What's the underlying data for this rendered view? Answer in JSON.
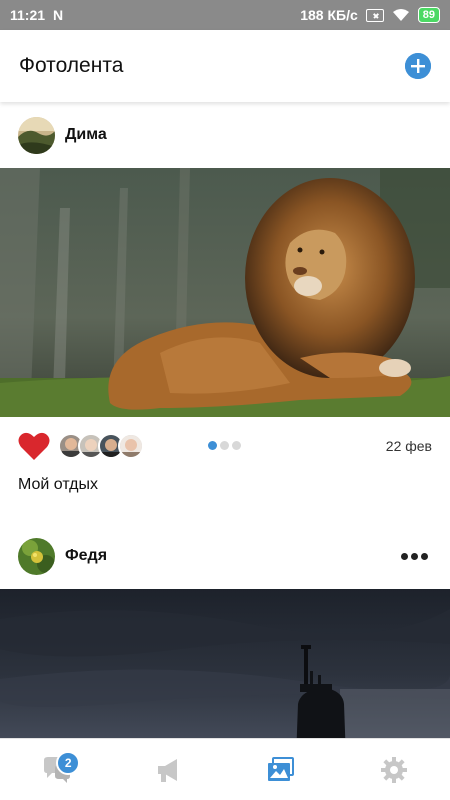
{
  "status_bar": {
    "time": "11:21",
    "notification_icon": "N",
    "network_speed": "188 КБ/с",
    "battery": "89"
  },
  "header": {
    "title": "Фотолента",
    "add_icon": "plus-circle-icon"
  },
  "colors": {
    "accent": "#3d8fd6",
    "like": "#d9272d",
    "status_bar": "#8a8a8a",
    "battery": "#4cd964"
  },
  "posts": [
    {
      "author": "Дима",
      "image": "lion photo",
      "liked": true,
      "likers_count": 4,
      "carousel": {
        "current": 1,
        "total": 3
      },
      "date": "22 фев",
      "caption": "Мой отдых"
    },
    {
      "author": "Федя",
      "image": "submarine photo",
      "more_icon": "more-horizontal-icon"
    }
  ],
  "tab_bar": {
    "tabs": [
      {
        "name": "messages",
        "icon": "chat-bubbles-icon",
        "badge": "2",
        "active": false
      },
      {
        "name": "news",
        "icon": "megaphone-icon",
        "active": false
      },
      {
        "name": "photos",
        "icon": "photo-gallery-icon",
        "active": true
      },
      {
        "name": "settings",
        "icon": "gear-icon",
        "active": false
      }
    ]
  }
}
